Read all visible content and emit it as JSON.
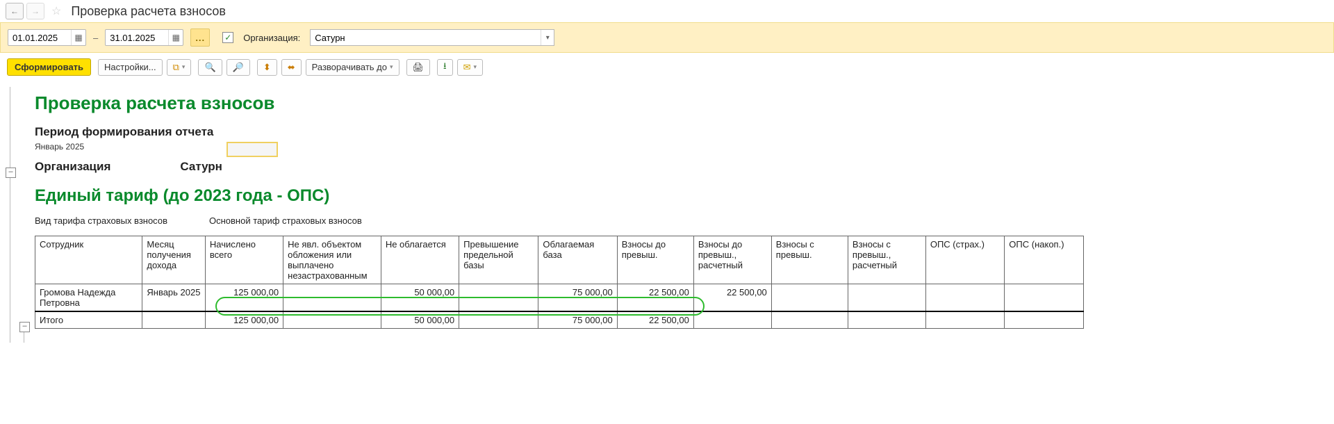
{
  "nav": {
    "back": "←",
    "forward": "→",
    "star": "☆",
    "title": "Проверка расчета взносов"
  },
  "filter": {
    "date_from": "01.01.2025",
    "date_to": "31.01.2025",
    "dash": "–",
    "ellipsis": "...",
    "check": "✓",
    "org_label": "Организация:",
    "org_value": "Сатурн"
  },
  "toolbar": {
    "generate": "Сформировать",
    "settings": "Настройки...",
    "expand_to": "Разворачивать до"
  },
  "report": {
    "title": "Проверка расчета взносов",
    "period_label": "Период формирования отчета",
    "period_value": "Январь 2025",
    "org_label": "Организация",
    "org_value": "Сатурн",
    "section_title": "Единый тариф (до 2023 года - ОПС)",
    "tarif_type_label": "Вид тарифа страховых взносов",
    "tarif_type_value": "Основной тариф страховых взносов",
    "headers": {
      "employee": "Сотрудник",
      "month": "Месяц получения дохода",
      "accrued": "Начислено всего",
      "not_object": "Не явл. объектом обложения или выплачено незастрахованным",
      "not_taxed": "Не облагается",
      "exceed_base": "Превышение предельной базы",
      "tax_base": "Облагаемая база",
      "contrib_before": "Взносы до превыш.",
      "contrib_before_calc": "Взносы до превыш., расчетный",
      "contrib_after": "Взносы с превыш.",
      "contrib_after_calc": "Взносы с превыш., расчетный",
      "ops_insur": "ОПС (страх.)",
      "ops_accum": "ОПС (накоп.)"
    },
    "row": {
      "employee": "Громова Надежда Петровна",
      "month": "Январь 2025",
      "accrued": "125 000,00",
      "not_taxed": "50 000,00",
      "tax_base": "75 000,00",
      "contrib_before": "22 500,00",
      "contrib_before_calc": "22 500,00"
    },
    "total": {
      "label": "Итого",
      "accrued": "125 000,00",
      "not_taxed": "50 000,00",
      "tax_base": "75 000,00",
      "contrib_before": "22 500,00"
    }
  },
  "chart_data": {
    "type": "table",
    "title": "Единый тариф (до 2023 года - ОПС)",
    "columns": [
      "Сотрудник",
      "Месяц получения дохода",
      "Начислено всего",
      "Не явл. объектом обложения или выплачено незастрахованным",
      "Не облагается",
      "Превышение предельной базы",
      "Облагаемая база",
      "Взносы до превыш.",
      "Взносы до превыш., расчетный",
      "Взносы с превыш.",
      "Взносы с превыш., расчетный",
      "ОПС (страх.)",
      "ОПС (накоп.)"
    ],
    "rows": [
      [
        "Громова Надежда Петровна",
        "Январь 2025",
        125000.0,
        null,
        50000.0,
        null,
        75000.0,
        22500.0,
        22500.0,
        null,
        null,
        null,
        null
      ]
    ],
    "totals": [
      null,
      null,
      125000.0,
      null,
      50000.0,
      null,
      75000.0,
      22500.0,
      null,
      null,
      null,
      null,
      null
    ]
  }
}
